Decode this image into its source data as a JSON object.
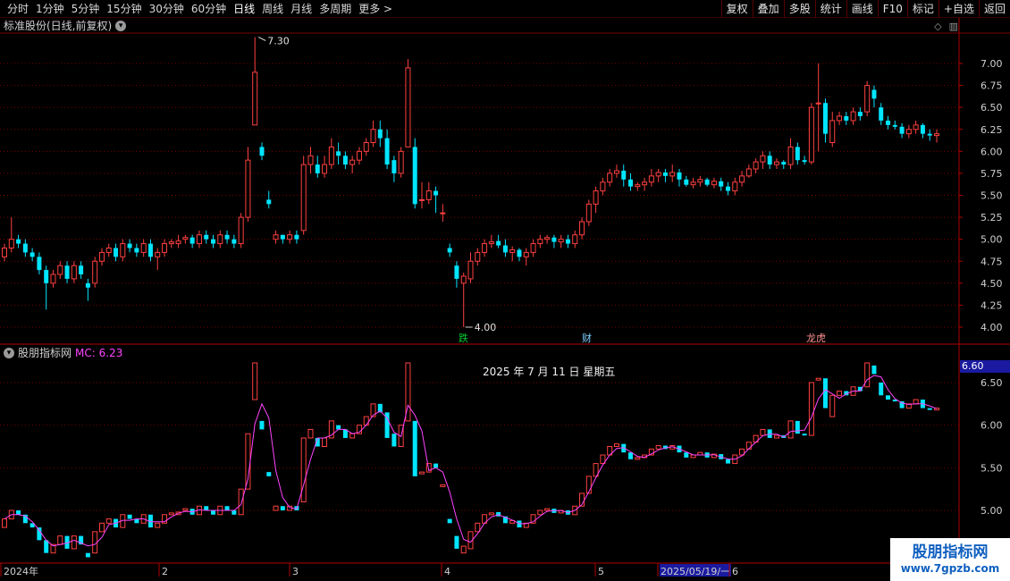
{
  "toolbar": {
    "timeframes": [
      "分时",
      "1分钟",
      "5分钟",
      "15分钟",
      "30分钟",
      "60分钟",
      "日线",
      "周线",
      "月线",
      "多周期",
      "更多 >"
    ],
    "active": "日线",
    "right_buttons": [
      "复权",
      "叠加",
      "多股",
      "统计",
      "画线",
      "F10",
      "标记",
      "+自选",
      "返回"
    ]
  },
  "stock_panel": {
    "title": "标准股份(日线,前复权)",
    "high_label": "7.30",
    "low_label": "4.00",
    "y_axis": [
      "7.00",
      "6.75",
      "6.50",
      "6.25",
      "6.00",
      "5.75",
      "5.50",
      "5.25",
      "5.00",
      "4.75",
      "4.50",
      "4.25",
      "4.00"
    ],
    "markers": [
      {
        "text": "跌",
        "color": "#00cc33"
      },
      {
        "text": "财",
        "color": "#7fd0ff"
      },
      {
        "text": "龙虎",
        "color": "#ff9090"
      }
    ]
  },
  "indicator_panel": {
    "name": "股朋指标网",
    "mc_label": "MC: 6.23",
    "y_axis": [
      "6.50",
      "6.00",
      "5.50",
      "5.00"
    ],
    "current_price": "6.60",
    "date_text": "2025 年 7 月 11 日 星期五"
  },
  "time_axis": {
    "labels": [
      "2024年",
      "2",
      "3",
      "4",
      "5",
      "2025/05/19/一",
      "6"
    ]
  },
  "watermark": {
    "line1": "股朋指标网",
    "line2": "www.7gpzb.com"
  },
  "colors": {
    "up": "#ff4040",
    "down": "#00e5ff",
    "mc_line": "#ff44ff",
    "grid": "#7a0000"
  },
  "chart_data": {
    "type": "candlestick",
    "ylim": [
      4.0,
      7.3
    ],
    "candles": [
      [
        4.8,
        4.9,
        4.75,
        4.95
      ],
      [
        4.9,
        5.0,
        4.85,
        5.25
      ],
      [
        5.0,
        4.95,
        4.9,
        5.05
      ],
      [
        4.95,
        4.85,
        4.8,
        5.0
      ],
      [
        4.85,
        4.8,
        4.75,
        4.9
      ],
      [
        4.8,
        4.65,
        4.6,
        4.85
      ],
      [
        4.65,
        4.5,
        4.2,
        4.7
      ],
      [
        4.5,
        4.6,
        4.45,
        4.65
      ],
      [
        4.6,
        4.7,
        4.55,
        4.75
      ],
      [
        4.7,
        4.55,
        4.5,
        4.75
      ],
      [
        4.55,
        4.7,
        4.5,
        4.75
      ],
      [
        4.7,
        4.6,
        4.55,
        4.75
      ],
      [
        4.5,
        4.45,
        4.3,
        4.55
      ],
      [
        4.5,
        4.75,
        4.45,
        4.8
      ],
      [
        4.75,
        4.85,
        4.7,
        4.9
      ],
      [
        4.85,
        4.9,
        4.8,
        4.95
      ],
      [
        4.9,
        4.8,
        4.75,
        4.95
      ],
      [
        4.8,
        4.95,
        4.75,
        5.0
      ],
      [
        4.95,
        4.9,
        4.85,
        5.0
      ],
      [
        4.9,
        4.85,
        4.8,
        4.95
      ],
      [
        4.85,
        4.95,
        4.8,
        5.0
      ],
      [
        4.95,
        4.8,
        4.75,
        5.0
      ],
      [
        4.8,
        4.85,
        4.65,
        4.9
      ],
      [
        4.85,
        4.95,
        4.8,
        5.0
      ],
      [
        4.95,
        4.97,
        4.9,
        5.0
      ],
      [
        4.95,
        4.98,
        4.9,
        5.05
      ],
      [
        5.0,
        5.02,
        4.95,
        5.05
      ],
      [
        5.02,
        4.95,
        4.9,
        5.05
      ],
      [
        4.95,
        5.05,
        4.9,
        5.1
      ],
      [
        5.05,
        5.0,
        4.95,
        5.1
      ],
      [
        5.0,
        4.95,
        4.9,
        5.05
      ],
      [
        4.95,
        5.05,
        4.9,
        5.1
      ],
      [
        5.05,
        5.0,
        4.95,
        5.1
      ],
      [
        5.0,
        4.95,
        4.9,
        5.05
      ],
      [
        4.95,
        5.25,
        4.9,
        5.3
      ],
      [
        5.25,
        5.9,
        5.2,
        6.05
      ],
      [
        6.3,
        6.9,
        6.5,
        7.3
      ],
      [
        6.05,
        5.95,
        5.9,
        6.1
      ],
      [
        5.45,
        5.4,
        5.35,
        5.55
      ],
      [
        5.0,
        5.05,
        4.95,
        5.1
      ],
      [
        5.05,
        5.0,
        4.95,
        5.05
      ],
      [
        5.0,
        5.05,
        4.95,
        5.1
      ],
      [
        5.05,
        5.0,
        4.95,
        5.1
      ],
      [
        5.1,
        5.85,
        5.05,
        5.95
      ],
      [
        5.85,
        5.95,
        5.75,
        6.05
      ],
      [
        5.85,
        5.75,
        5.7,
        5.95
      ],
      [
        5.75,
        5.85,
        5.7,
        5.95
      ],
      [
        5.85,
        6.05,
        5.8,
        6.15
      ],
      [
        6.0,
        5.95,
        5.85,
        6.1
      ],
      [
        5.95,
        5.85,
        5.8,
        6.0
      ],
      [
        5.85,
        5.9,
        5.75,
        5.95
      ],
      [
        5.9,
        6.0,
        5.85,
        6.05
      ],
      [
        6.0,
        6.1,
        5.95,
        6.15
      ],
      [
        6.1,
        6.25,
        6.05,
        6.35
      ],
      [
        6.25,
        6.15,
        6.05,
        6.35
      ],
      [
        6.15,
        5.85,
        5.8,
        6.25
      ],
      [
        5.9,
        5.75,
        5.65,
        5.95
      ],
      [
        5.75,
        6.0,
        5.7,
        6.05
      ],
      [
        6.05,
        6.95,
        6.5,
        7.05
      ],
      [
        6.05,
        5.4,
        5.35,
        6.15
      ],
      [
        5.45,
        5.45,
        5.35,
        5.65
      ],
      [
        5.45,
        5.55,
        5.4,
        5.65
      ],
      [
        5.55,
        5.5,
        5.3,
        5.6
      ],
      [
        5.3,
        5.3,
        5.2,
        5.4
      ],
      [
        4.9,
        4.85,
        4.8,
        4.95
      ],
      [
        4.7,
        4.55,
        4.45,
        4.75
      ],
      [
        4.5,
        4.58,
        4.0,
        4.62
      ],
      [
        4.55,
        4.75,
        4.5,
        4.85
      ],
      [
        4.75,
        4.85,
        4.7,
        4.9
      ],
      [
        4.85,
        4.95,
        4.8,
        5.0
      ],
      [
        4.95,
        4.97,
        4.9,
        5.05
      ],
      [
        4.98,
        4.93,
        4.9,
        5.05
      ],
      [
        4.93,
        4.85,
        4.8,
        5.0
      ],
      [
        4.85,
        4.88,
        4.75,
        4.92
      ],
      [
        4.88,
        4.8,
        4.75,
        4.9
      ],
      [
        4.8,
        4.85,
        4.7,
        4.9
      ],
      [
        4.85,
        4.95,
        4.8,
        5.0
      ],
      [
        4.95,
        5.0,
        4.9,
        5.05
      ],
      [
        5.0,
        5.02,
        4.95,
        5.05
      ],
      [
        5.02,
        4.97,
        4.9,
        5.05
      ],
      [
        4.97,
        5.0,
        4.9,
        5.05
      ],
      [
        5.0,
        4.95,
        4.9,
        5.05
      ],
      [
        4.95,
        5.05,
        4.9,
        5.1
      ],
      [
        5.05,
        5.2,
        5.0,
        5.25
      ],
      [
        5.2,
        5.4,
        5.15,
        5.45
      ],
      [
        5.4,
        5.55,
        5.3,
        5.6
      ],
      [
        5.55,
        5.65,
        5.5,
        5.7
      ],
      [
        5.65,
        5.75,
        5.6,
        5.8
      ],
      [
        5.75,
        5.78,
        5.7,
        5.85
      ],
      [
        5.78,
        5.68,
        5.6,
        5.85
      ],
      [
        5.68,
        5.6,
        5.55,
        5.75
      ],
      [
        5.6,
        5.62,
        5.55,
        5.65
      ],
      [
        5.62,
        5.65,
        5.55,
        5.7
      ],
      [
        5.65,
        5.72,
        5.6,
        5.8
      ],
      [
        5.72,
        5.76,
        5.65,
        5.8
      ],
      [
        5.76,
        5.72,
        5.65,
        5.8
      ],
      [
        5.72,
        5.76,
        5.65,
        5.85
      ],
      [
        5.76,
        5.68,
        5.6,
        5.8
      ],
      [
        5.68,
        5.62,
        5.6,
        5.72
      ],
      [
        5.62,
        5.65,
        5.58,
        5.7
      ],
      [
        5.65,
        5.68,
        5.6,
        5.72
      ],
      [
        5.68,
        5.62,
        5.6,
        5.7
      ],
      [
        5.62,
        5.66,
        5.58,
        5.7
      ],
      [
        5.66,
        5.6,
        5.55,
        5.7
      ],
      [
        5.6,
        5.55,
        5.5,
        5.65
      ],
      [
        5.55,
        5.65,
        5.5,
        5.7
      ],
      [
        5.65,
        5.72,
        5.6,
        5.78
      ],
      [
        5.72,
        5.8,
        5.7,
        5.85
      ],
      [
        5.8,
        5.88,
        5.75,
        5.92
      ],
      [
        5.88,
        5.95,
        5.8,
        6.0
      ],
      [
        5.95,
        5.85,
        5.8,
        6.0
      ],
      [
        5.85,
        5.88,
        5.8,
        5.92
      ],
      [
        5.88,
        5.85,
        5.8,
        5.9
      ],
      [
        5.85,
        6.05,
        5.8,
        6.15
      ],
      [
        6.05,
        5.9,
        5.85,
        6.1
      ],
      [
        5.9,
        5.88,
        5.85,
        5.95
      ],
      [
        5.88,
        6.5,
        5.85,
        6.55
      ],
      [
        6.55,
        6.55,
        6.0,
        7.0
      ],
      [
        6.55,
        6.2,
        6.1,
        6.6
      ],
      [
        6.1,
        6.35,
        6.05,
        6.45
      ],
      [
        6.35,
        6.4,
        6.3,
        6.45
      ],
      [
        6.4,
        6.35,
        6.3,
        6.45
      ],
      [
        6.35,
        6.45,
        6.3,
        6.5
      ],
      [
        6.45,
        6.4,
        6.35,
        6.5
      ],
      [
        6.45,
        6.75,
        6.4,
        6.8
      ],
      [
        6.7,
        6.6,
        6.5,
        6.75
      ],
      [
        6.5,
        6.35,
        6.3,
        6.55
      ],
      [
        6.35,
        6.3,
        6.25,
        6.4
      ],
      [
        6.3,
        6.28,
        6.25,
        6.35
      ],
      [
        6.28,
        6.2,
        6.15,
        6.32
      ],
      [
        6.2,
        6.25,
        6.15,
        6.3
      ],
      [
        6.25,
        6.3,
        6.2,
        6.35
      ],
      [
        6.3,
        6.2,
        6.15,
        6.32
      ],
      [
        6.2,
        6.18,
        6.12,
        6.25
      ],
      [
        6.18,
        6.2,
        6.1,
        6.25
      ]
    ],
    "indicator": {
      "name": "MC",
      "ylim": [
        4.5,
        6.85
      ],
      "last_value": 6.23
    }
  }
}
